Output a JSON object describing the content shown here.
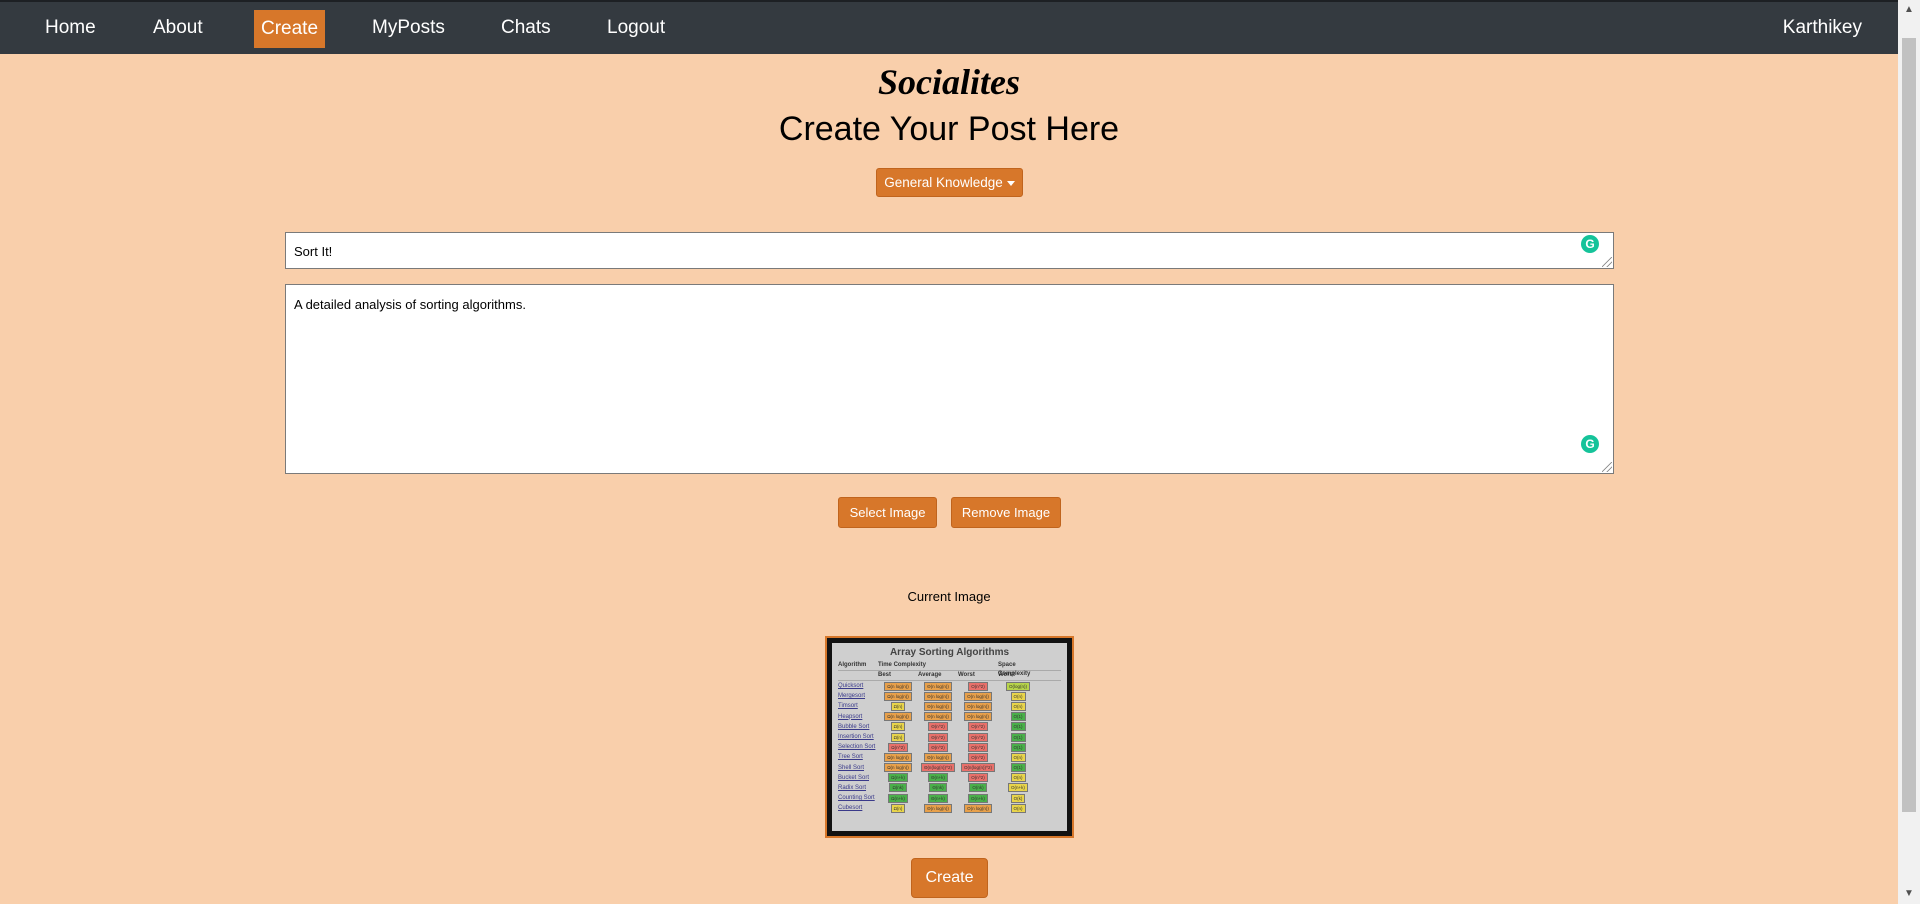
{
  "nav": {
    "links": [
      "Home",
      "About",
      "Create",
      "MyPosts",
      "Chats",
      "Logout"
    ],
    "active": "Create",
    "user": "Karthikey"
  },
  "brand": "Socialites",
  "heading": "Create Your Post Here",
  "category_dropdown": {
    "selected": "General Knowledge"
  },
  "form": {
    "title_value": "Sort It!",
    "body_value": "A detailed analysis of sorting algorithms."
  },
  "buttons": {
    "select_image": "Select Image",
    "remove_image": "Remove Image",
    "create": "Create"
  },
  "current_image_label": "Current Image",
  "preview": {
    "title": "Array Sorting Algorithms",
    "headers": [
      "Algorithm",
      "Time Complexity",
      "Space Complexity"
    ],
    "subheaders": [
      "Best",
      "Average",
      "Worst",
      "Worst"
    ],
    "rows": [
      {
        "name": "Quicksort",
        "cells": [
          "Ω(n log(n))",
          "Θ(n log(n))",
          "O(n^2)",
          "O(log(n))"
        ],
        "colors": [
          "#e8a04a",
          "#e8a04a",
          "#e8706a",
          "#b7d44a"
        ]
      },
      {
        "name": "Mergesort",
        "cells": [
          "Ω(n log(n))",
          "Θ(n log(n))",
          "O(n log(n))",
          "O(n)"
        ],
        "colors": [
          "#e8a04a",
          "#e8a04a",
          "#e8a04a",
          "#e8d44a"
        ]
      },
      {
        "name": "Timsort",
        "cells": [
          "Ω(n)",
          "Θ(n log(n))",
          "O(n log(n))",
          "O(n)"
        ],
        "colors": [
          "#e8d44a",
          "#e8a04a",
          "#e8a04a",
          "#e8d44a"
        ]
      },
      {
        "name": "Heapsort",
        "cells": [
          "Ω(n log(n))",
          "Θ(n log(n))",
          "O(n log(n))",
          "O(1)"
        ],
        "colors": [
          "#e8a04a",
          "#e8a04a",
          "#e8a04a",
          "#4ab04a"
        ]
      },
      {
        "name": "Bubble Sort",
        "cells": [
          "Ω(n)",
          "Θ(n^2)",
          "O(n^2)",
          "O(1)"
        ],
        "colors": [
          "#e8d44a",
          "#e8706a",
          "#e8706a",
          "#4ab04a"
        ]
      },
      {
        "name": "Insertion Sort",
        "cells": [
          "Ω(n)",
          "Θ(n^2)",
          "O(n^2)",
          "O(1)"
        ],
        "colors": [
          "#e8d44a",
          "#e8706a",
          "#e8706a",
          "#4ab04a"
        ]
      },
      {
        "name": "Selection Sort",
        "cells": [
          "Ω(n^2)",
          "Θ(n^2)",
          "O(n^2)",
          "O(1)"
        ],
        "colors": [
          "#e8706a",
          "#e8706a",
          "#e8706a",
          "#4ab04a"
        ]
      },
      {
        "name": "Tree Sort",
        "cells": [
          "Ω(n log(n))",
          "Θ(n log(n))",
          "O(n^2)",
          "O(n)"
        ],
        "colors": [
          "#e8a04a",
          "#e8a04a",
          "#e8706a",
          "#e8d44a"
        ]
      },
      {
        "name": "Shell Sort",
        "cells": [
          "Ω(n log(n))",
          "Θ(n(log(n))^2)",
          "O(n(log(n))^2)",
          "O(1)"
        ],
        "colors": [
          "#e8a04a",
          "#e8706a",
          "#e8706a",
          "#4ab04a"
        ]
      },
      {
        "name": "Bucket Sort",
        "cells": [
          "Ω(n+k)",
          "Θ(n+k)",
          "O(n^2)",
          "O(n)"
        ],
        "colors": [
          "#4ab04a",
          "#4ab04a",
          "#e8706a",
          "#e8d44a"
        ]
      },
      {
        "name": "Radix Sort",
        "cells": [
          "Ω(nk)",
          "Θ(nk)",
          "O(nk)",
          "O(n+k)"
        ],
        "colors": [
          "#4ab04a",
          "#4ab04a",
          "#4ab04a",
          "#e8d44a"
        ]
      },
      {
        "name": "Counting Sort",
        "cells": [
          "Ω(n+k)",
          "Θ(n+k)",
          "O(n+k)",
          "O(k)"
        ],
        "colors": [
          "#4ab04a",
          "#4ab04a",
          "#4ab04a",
          "#e8d44a"
        ]
      },
      {
        "name": "Cubesort",
        "cells": [
          "Ω(n)",
          "Θ(n log(n))",
          "O(n log(n))",
          "O(n)"
        ],
        "colors": [
          "#e8d44a",
          "#e8a04a",
          "#e8a04a",
          "#e8d44a"
        ]
      }
    ]
  },
  "colors": {
    "accent": "#d7772a",
    "navbar": "#343a40",
    "background": "#f9cfab",
    "grammarly": "#15c39a"
  },
  "icons": [
    "grammarly-icon",
    "caret-down-icon",
    "resize-grip-icon"
  ]
}
